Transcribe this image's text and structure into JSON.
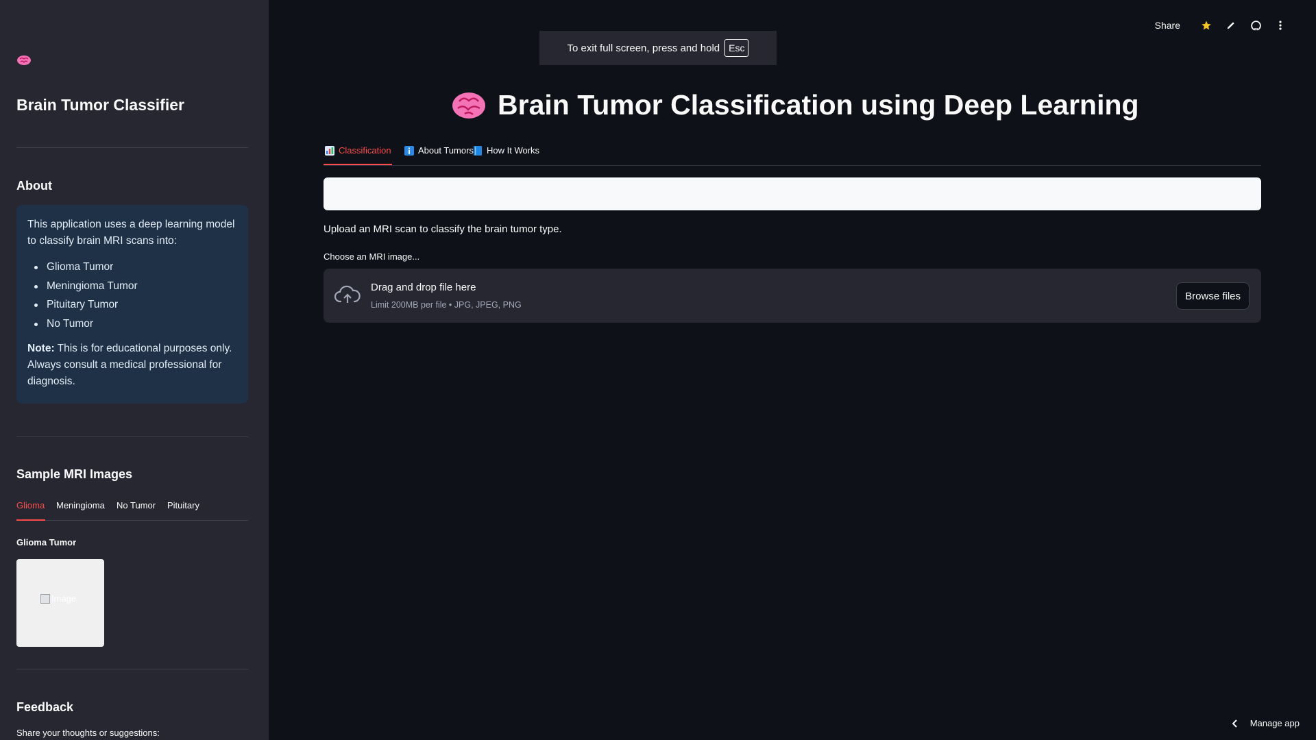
{
  "sidebar": {
    "title": "Brain Tumor Classifier",
    "about_heading": "About",
    "about_intro": "This application uses a deep learning model to classify brain MRI scans into:",
    "classes": [
      "Glioma Tumor",
      "Meningioma Tumor",
      "Pituitary Tumor",
      "No Tumor"
    ],
    "note_label": "Note:",
    "note_text": " This is for educational purposes only. Always consult a medical professional for diagnosis.",
    "samples_heading": "Sample MRI Images",
    "sample_tabs": [
      "Glioma",
      "Meningioma",
      "No Tumor",
      "Pituitary"
    ],
    "sample_active": "Glioma",
    "sample_subheading": "Glioma Tumor",
    "sample_image_alt": "Image",
    "feedback_heading": "Feedback",
    "feedback_label": "Share your thoughts or suggestions:"
  },
  "banner": {
    "text": "To exit full screen, press and hold",
    "key": "Esc"
  },
  "toolbar": {
    "share_label": "Share",
    "icons": [
      "star-icon",
      "edit-icon",
      "github-icon",
      "more-vertical-icon"
    ]
  },
  "main": {
    "title": "Brain Tumor Classification using Deep Learning",
    "tabs": [
      {
        "label": "Classification",
        "icon": "bar-chart-icon"
      },
      {
        "label": "About Tumors",
        "icon": "info-icon"
      },
      {
        "label": "How It Works",
        "icon": "book-icon"
      }
    ],
    "active_tab": "Classification",
    "upload_prompt": "Upload an MRI scan to classify the brain tumor type.",
    "uploader_label": "Choose an MRI image...",
    "dropzone_title": "Drag and drop file here",
    "dropzone_subtitle": "Limit 200MB per file • JPG, JPEG, PNG",
    "browse_label": "Browse files"
  },
  "footer": {
    "manage_app": "Manage app"
  },
  "colors": {
    "background": "#0e1117",
    "sidebar": "#262730",
    "accent": "#ff4b4b",
    "info_box": "#1f3147"
  }
}
